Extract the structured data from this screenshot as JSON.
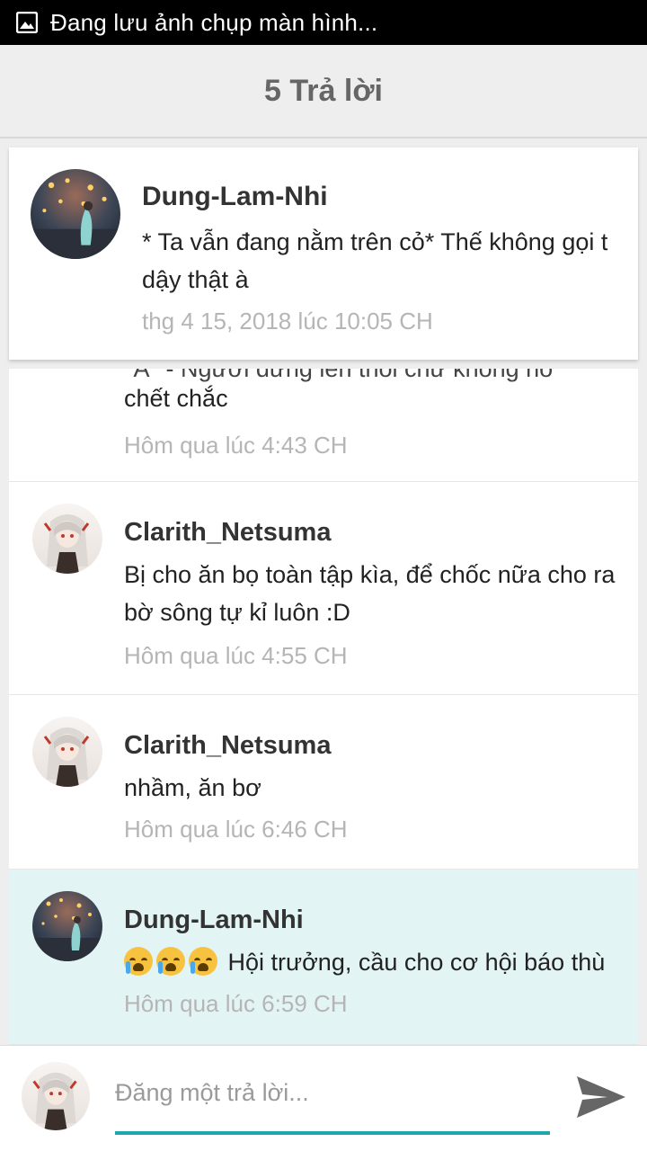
{
  "status_bar": {
    "text": "Đang lưu ảnh chụp màn hình..."
  },
  "header": {
    "title": "5 Trả lời"
  },
  "pinned": {
    "author": "Dung-Lam-Nhi",
    "text": "* Ta vẫn đang nằm trên cỏ*  Thế không gọi t dậy thật à",
    "time": "thg 4 15, 2018 lúc 10:05 CH",
    "avatar": "lanterns-avatar"
  },
  "partial": {
    "cut_text": "*Á* - Ngươi đứng lên thôi chứ không nó",
    "text": "chết chắc",
    "time": "Hôm qua lúc 4:43 CH"
  },
  "replies": [
    {
      "author": "Clarith_Netsuma",
      "text": "Bị cho ăn bọ toàn tập kìa, để chốc nữa cho ra bờ sông tự kỉ luôn :D",
      "time": "Hôm qua lúc 4:55 CH",
      "avatar": "anime-girl-avatar"
    },
    {
      "author": "Clarith_Netsuma",
      "text": "nhầm, ăn bơ",
      "time": "Hôm qua lúc 6:46 CH",
      "avatar": "anime-girl-avatar"
    },
    {
      "author": "Dung-Lam-Nhi",
      "text": "Hội trưởng, cầu cho cơ hội báo thù",
      "emojis": [
        "crying-face",
        "crying-face",
        "crying-face"
      ],
      "time": "Hôm qua lúc 6:59 CH",
      "avatar": "lanterns-avatar",
      "highlighted": true
    }
  ],
  "composer": {
    "placeholder": "Đăng một trả lời...",
    "send_icon": "send-icon"
  },
  "colors": {
    "accent": "#1ea5ad",
    "highlight_bg": "#e3f4f5",
    "timestamp": "#b5b5b5"
  }
}
